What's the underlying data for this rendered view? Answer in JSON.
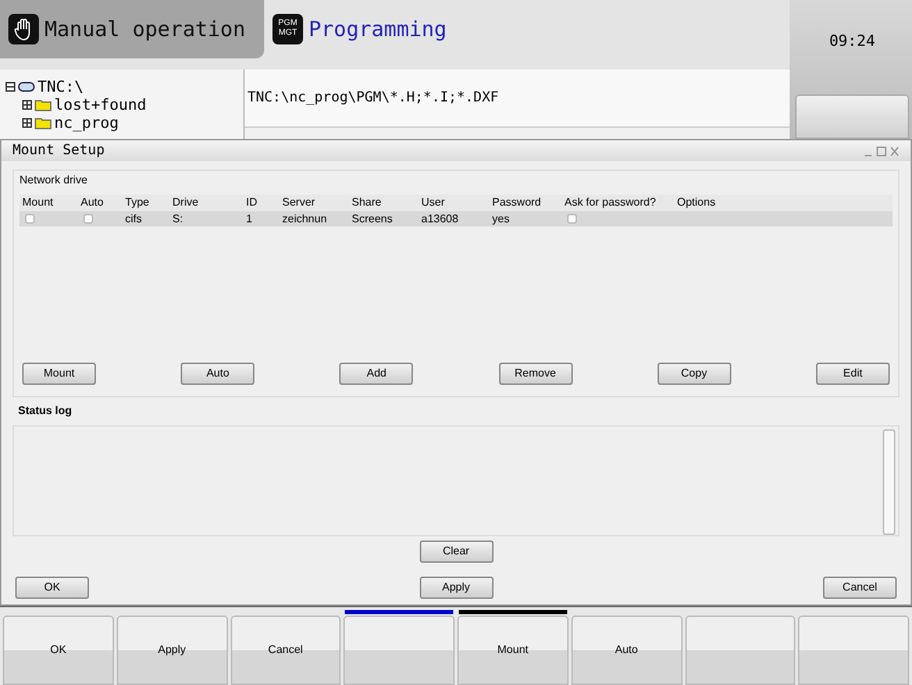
{
  "mode_tabs": [
    {
      "label": "Manual operation",
      "selected": true
    },
    {
      "label": "Programming",
      "selected": false
    }
  ],
  "pgm_icon_text": [
    "PGM",
    "MGT"
  ],
  "clock": "09:24",
  "tree": [
    {
      "label": "TNC:\\",
      "kind": "drive",
      "expanded": true,
      "children": [
        {
          "label": "lost+found",
          "kind": "folder",
          "expanded": false
        },
        {
          "label": "nc_prog",
          "kind": "folder",
          "expanded": false
        }
      ]
    }
  ],
  "path": "TNC:\\nc_prog\\PGM\\*.H;*.I;*.DXF",
  "dialog": {
    "title": "Mount Setup",
    "group": "Network drive",
    "columns": [
      "Mount",
      "Auto",
      "Type",
      "Drive",
      "ID",
      "Server",
      "Share",
      "User",
      "Password",
      "Ask for password?",
      "Options"
    ],
    "rows": [
      {
        "selected": true,
        "mount": false,
        "auto": false,
        "type": "cifs",
        "drive": "S:",
        "id": "1",
        "server": "zeichnun",
        "share": "Screens",
        "user": "a13608",
        "password": "yes",
        "ask_password": false
      }
    ],
    "buttons": [
      "Mount",
      "Auto",
      "Add",
      "Remove",
      "Copy",
      "Edit"
    ],
    "status_log": "Status log",
    "clear": "Clear",
    "footer": [
      "OK",
      "Apply",
      "Cancel"
    ]
  },
  "softkeys": [
    {
      "kind": "softkey",
      "label": "OK"
    },
    {
      "kind": "softkey",
      "label": "Apply"
    },
    {
      "kind": "softkey",
      "label": "Cancel"
    },
    {
      "kind": "softkey",
      "color": "#0000cc"
    },
    {
      "kind": "softkey",
      "label": "Mount",
      "color": "#000000"
    },
    {
      "kind": "softkey",
      "label": "Auto"
    },
    {
      "kind": "softkey"
    },
    {
      "kind": "softkey"
    }
  ]
}
